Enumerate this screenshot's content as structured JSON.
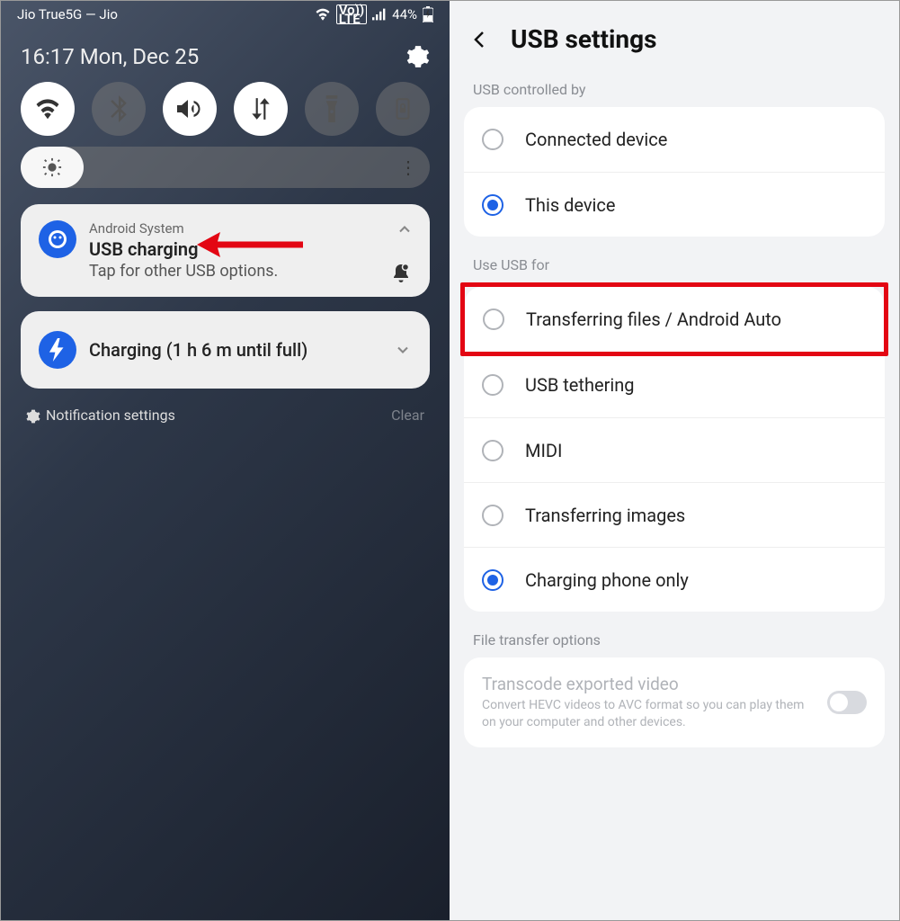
{
  "status": {
    "carrier": "Jio True5G — Jio",
    "battery": "44%"
  },
  "shade": {
    "time_date": "16:17  Mon, Dec 25"
  },
  "notification": {
    "source": "Android System",
    "title": "USB charging",
    "subtitle": "Tap for other USB options."
  },
  "charging": {
    "title": "Charging (1 h 6 m until full)"
  },
  "footer": {
    "settings": "Notification settings",
    "clear": "Clear"
  },
  "settings": {
    "title": "USB settings",
    "section1": "USB controlled by",
    "opt_connected": "Connected device",
    "opt_thisdevice": "This device",
    "section2": "Use USB for",
    "opt_transfer": "Transferring files / Android Auto",
    "opt_tether": "USB tethering",
    "opt_midi": "MIDI",
    "opt_images": "Transferring images",
    "opt_charging": "Charging phone only",
    "section3": "File transfer options",
    "transcode_title": "Transcode exported video",
    "transcode_desc": "Convert HEVC videos to AVC format so you can play them on your computer and other devices."
  }
}
